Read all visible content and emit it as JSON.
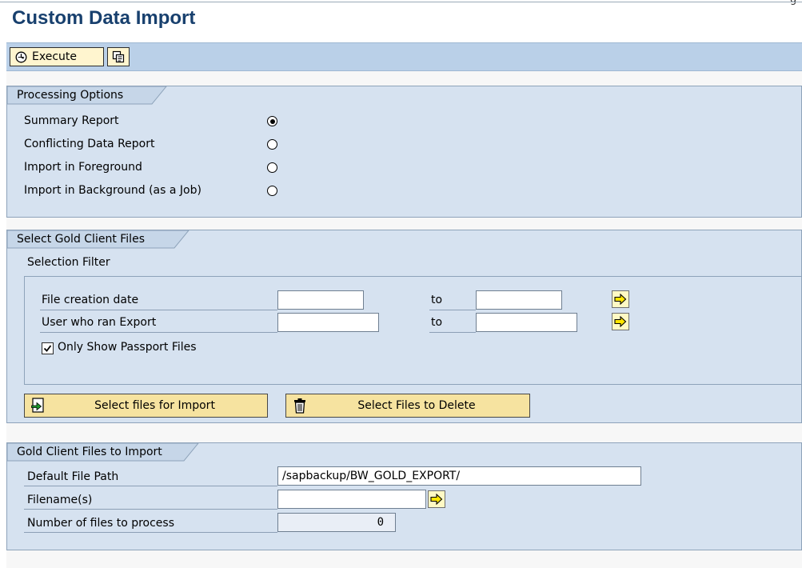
{
  "corner_text": "g",
  "page_title": "Custom Data Import",
  "toolbar": {
    "execute_label": "Execute"
  },
  "processing_options": {
    "title": "Processing Options",
    "options": [
      {
        "label": "Summary Report",
        "selected": true
      },
      {
        "label": "Conflicting Data Report",
        "selected": false
      },
      {
        "label": "Import in Foreground",
        "selected": false
      },
      {
        "label": "Import in Background (as a Job)",
        "selected": false
      }
    ]
  },
  "select_files": {
    "title": "Select Gold Client Files",
    "filter_title": "Selection Filter",
    "rows": [
      {
        "label": "File creation date",
        "from": "",
        "to_label": "to",
        "to": ""
      },
      {
        "label": "User who ran Export",
        "from": "",
        "to_label": "to",
        "to": ""
      }
    ],
    "passport_checkbox": {
      "label": "Only Show Passport Files",
      "checked": true
    },
    "import_button": "Select files for Import",
    "delete_button": "Select Files to Delete"
  },
  "files_to_import": {
    "title": "Gold Client Files to Import",
    "default_path_label": "Default File Path",
    "default_path_value": "/sapbackup/BW_GOLD_EXPORT/",
    "filenames_label": "Filename(s)",
    "filenames_value": "",
    "count_label": "Number of files to process",
    "count_value": "0"
  },
  "colors": {
    "title": "#18406e",
    "group_bg": "#d6e2f0",
    "toolbar_bg": "#bad0e8",
    "button_bg": "#f6e3a0"
  },
  "icons": [
    "execute-icon",
    "variant-icon",
    "multiple-selection-icon",
    "select-import-icon",
    "trash-icon",
    "checkmark-icon"
  ]
}
